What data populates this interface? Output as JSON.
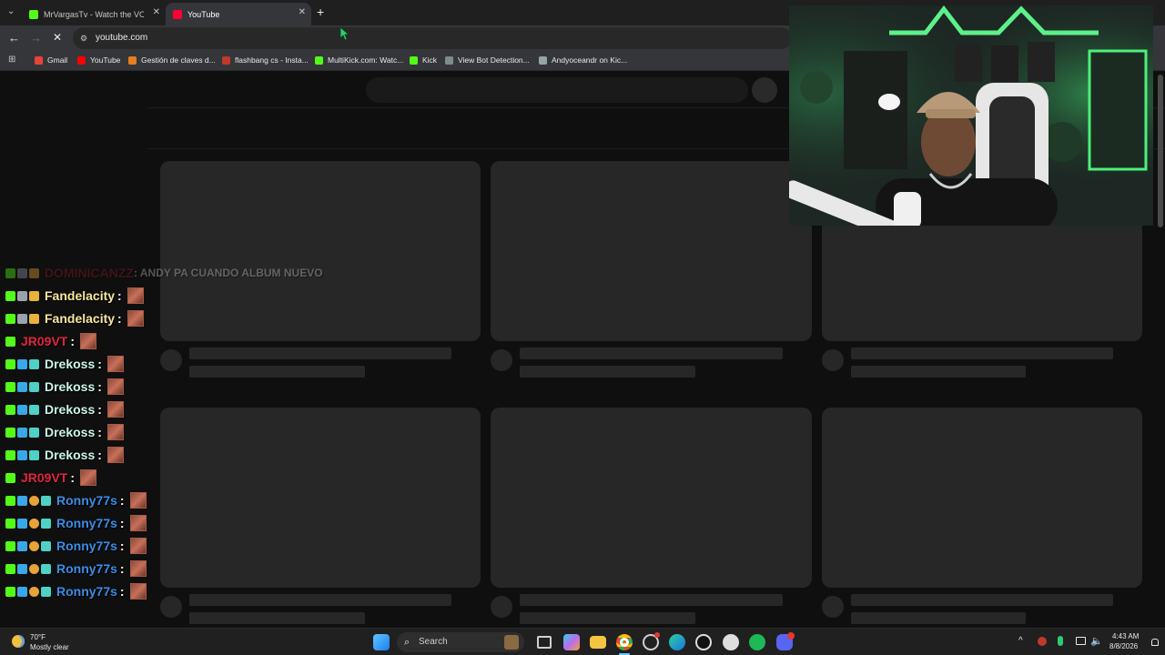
{
  "browser": {
    "tabs": [
      {
        "title": "MrVargasTv - Watch the VOD o",
        "active": false,
        "favicon_color": "#53fc18"
      },
      {
        "title": "YouTube",
        "active": true,
        "favicon_color": "#ff0033"
      }
    ],
    "new_tab": "+",
    "url": "youtube.com",
    "bookmarks": [
      {
        "label": "Gmail",
        "color": "#ea4335"
      },
      {
        "label": "YouTube",
        "color": "#ff0000"
      },
      {
        "label": "Gestión de claves d...",
        "color": "#e67e22"
      },
      {
        "label": "flashbang cs - Insta...",
        "color": "#c0392b"
      },
      {
        "label": "MultiKick.com: Watc...",
        "color": "#53fc18"
      },
      {
        "label": "Kick",
        "color": "#53fc18"
      },
      {
        "label": "View Bot Detection...",
        "color": "#7f8c8d"
      },
      {
        "label": "Andyoceandr on Kic...",
        "color": "#95a5a6"
      }
    ]
  },
  "chat": {
    "messages": [
      {
        "user": "DOMINICANZZ",
        "text": ": ANDY PA CUANDO ALBUM NUEVO",
        "color": "#8b1a2a",
        "faded": true
      },
      {
        "user": "Fandelacity",
        "text": ":",
        "color": "#f5e79e"
      },
      {
        "user": "Fandelacity",
        "text": ":",
        "color": "#f5e79e"
      },
      {
        "user": "JR09VT",
        "text": ":",
        "color": "#e0263f"
      },
      {
        "user": "Drekoss",
        "text": ":",
        "color": "#c9f7e8"
      },
      {
        "user": "Drekoss",
        "text": ":",
        "color": "#c9f7e8"
      },
      {
        "user": "Drekoss",
        "text": ":",
        "color": "#c9f7e8"
      },
      {
        "user": "Drekoss",
        "text": ":",
        "color": "#c9f7e8"
      },
      {
        "user": "Drekoss",
        "text": ":",
        "color": "#c9f7e8"
      },
      {
        "user": "JR09VT",
        "text": ":",
        "color": "#e0263f"
      },
      {
        "user": "Ronny77s",
        "text": ":",
        "color": "#3b8de6"
      },
      {
        "user": "Ronny77s",
        "text": ":",
        "color": "#3b8de6"
      },
      {
        "user": "Ronny77s",
        "text": ":",
        "color": "#3b8de6"
      },
      {
        "user": "Ronny77s",
        "text": ":",
        "color": "#3b8de6"
      },
      {
        "user": "Ronny77s",
        "text": ":",
        "color": "#3b8de6"
      }
    ]
  },
  "taskbar": {
    "weather_temp": "70°F",
    "weather_desc": "Mostly clear",
    "search_label": "Search",
    "time": "4:43 AM",
    "date": "8/8/2026"
  }
}
